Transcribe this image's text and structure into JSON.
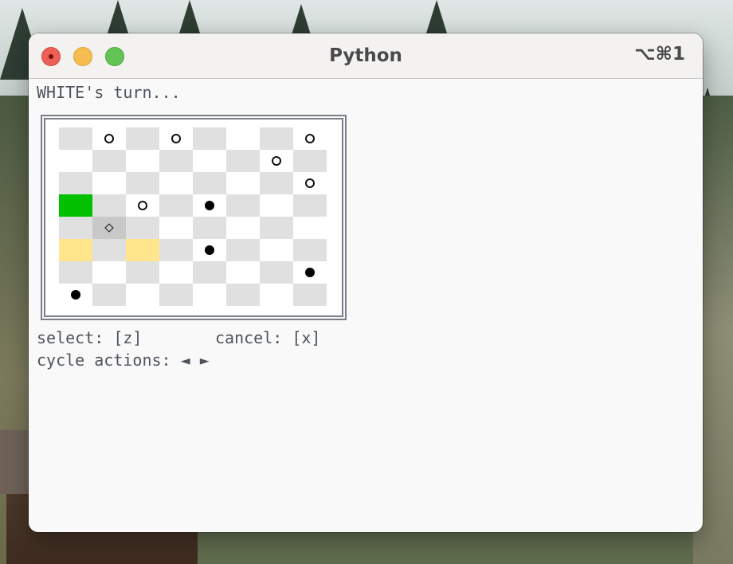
{
  "window": {
    "title": "Python",
    "shortcut": "⌥⌘1"
  },
  "terminal": {
    "status": "WHITE's turn...",
    "select_hint": "select: [z]",
    "cancel_hint": "cancel: [x]",
    "cycle_hint": "cycle actions: ◄ ►"
  },
  "board": {
    "rows": 8,
    "cols": 8,
    "pieces": [
      {
        "row": 0,
        "col": 1,
        "color": "white"
      },
      {
        "row": 0,
        "col": 3,
        "color": "white"
      },
      {
        "row": 0,
        "col": 7,
        "color": "white"
      },
      {
        "row": 1,
        "col": 6,
        "color": "white"
      },
      {
        "row": 2,
        "col": 7,
        "color": "white"
      },
      {
        "row": 3,
        "col": 2,
        "color": "white"
      },
      {
        "row": 3,
        "col": 4,
        "color": "black"
      },
      {
        "row": 5,
        "col": 4,
        "color": "black"
      },
      {
        "row": 6,
        "col": 7,
        "color": "black"
      },
      {
        "row": 7,
        "col": 0,
        "color": "black"
      }
    ],
    "highlights": [
      {
        "row": 3,
        "col": 0,
        "kind": "green"
      },
      {
        "row": 5,
        "col": 0,
        "kind": "yellow"
      },
      {
        "row": 5,
        "col": 2,
        "kind": "yellow"
      },
      {
        "row": 4,
        "col": 1,
        "kind": "cursor"
      }
    ],
    "cursor": {
      "row": 4,
      "col": 1
    },
    "colors": {
      "dark_square": "#e0e0e0",
      "light_square": "#ffffff",
      "selected": "#00c000",
      "move_target": "#ffe58c",
      "cursor": "#c8c8c8"
    }
  }
}
